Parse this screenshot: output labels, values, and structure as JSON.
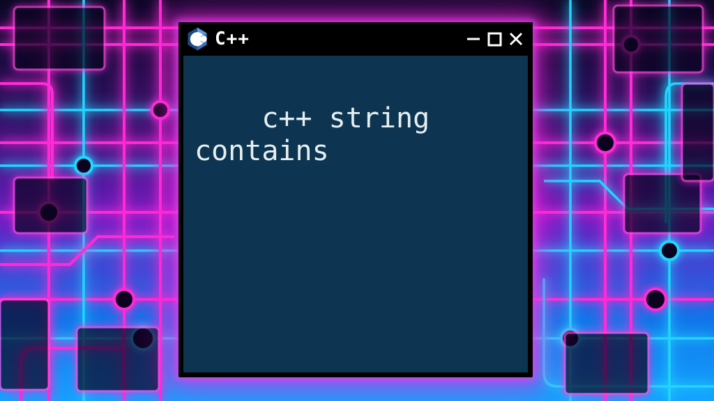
{
  "window": {
    "title": "C++",
    "logo_alt": "cpp-logo",
    "content": "c++ string contains"
  },
  "controls": {
    "minimize": "Minimize",
    "maximize": "Maximize",
    "close": "Close"
  },
  "colors": {
    "terminal_bg": "#0d3552",
    "neon_pink": "#ff2bd6",
    "neon_cyan": "#22d6ff"
  }
}
